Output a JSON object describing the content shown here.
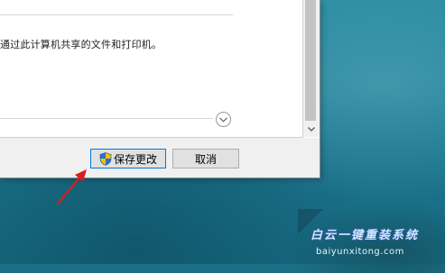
{
  "dialog": {
    "description": "通过此计算机共享的文件和打印机。",
    "buttons": {
      "save_label": "保存更改",
      "cancel_label": "取消"
    }
  },
  "icons": {
    "expand": "chevron-down-circle-icon",
    "scroll_down": "chevron-down-icon",
    "shield": "uac-shield-icon",
    "annotation": "red-arrow-icon"
  },
  "watermark": {
    "title": "白云一键重装系统",
    "subtitle": "baiyunxitong.com"
  },
  "colors": {
    "desktop": "#1d7890",
    "footer": "#f0f0f0",
    "button_focus_border": "#0078d7",
    "arrow": "#d42020"
  }
}
